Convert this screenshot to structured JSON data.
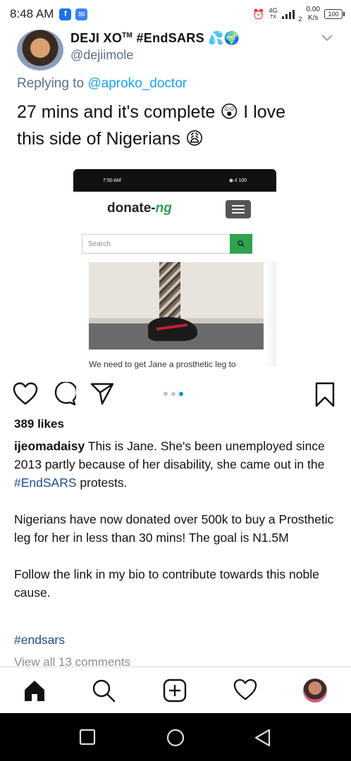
{
  "status_bar": {
    "time": "8:48 AM",
    "network_type": "4G",
    "network_sub": "TX",
    "sim_slot": "2",
    "speed_value": "0.00",
    "speed_unit": "K/s",
    "battery": "100"
  },
  "tweet": {
    "display_name": "DEJI XO",
    "display_name_tm": "TM",
    "display_name_tag": "#EndSARS",
    "display_name_emoji": "💦🌍",
    "handle": "@dejiimole",
    "replying_prefix": "Replying to",
    "replying_mention": "@aproko_doctor",
    "text_line1": "27 mins and it's complete 😲 I love",
    "text_line2": "this side of Nigerians 😩"
  },
  "embed": {
    "status_time": "7:50 AM",
    "status_icons": "◉.ıl 100",
    "logo_main": "donate-",
    "logo_ng": "ng",
    "search_placeholder": "Search",
    "caption": "We need to get Jane a prosthetic leg to"
  },
  "post": {
    "likes": "389 likes",
    "username": "ijeomadaisy",
    "caption_p1_text": " This is Jane. She's been unemployed since 2013 partly because of her disability, she came out in the ",
    "caption_p1_tag": "#EndSARS",
    "caption_p1_end": " protests.",
    "caption_p2": "Nigerians have now donated over 500k to buy a Prosthetic leg for her in less than 30 mins! The goal is N1.5M",
    "caption_p3": "Follow the link in my bio to contribute towards this noble cause.",
    "hashtag": "#endsars",
    "view_all": "View all 13 comments",
    "carousel_active_index": 2,
    "carousel_count": 3
  },
  "icons": {
    "like": "heart-icon",
    "comment": "comment-icon",
    "share": "send-icon",
    "save": "bookmark-icon",
    "nav": [
      "home-icon",
      "search-icon",
      "add-post-icon",
      "activity-heart-icon",
      "profile-avatar"
    ],
    "android": [
      "recents-square-icon",
      "home-circle-icon",
      "back-triangle-icon"
    ]
  },
  "colors": {
    "twitter_blue": "#1da1f2",
    "hashtag_blue": "#1e4b8f",
    "carousel_active": "#1a8cd8",
    "donate_green": "#2ea44f"
  }
}
